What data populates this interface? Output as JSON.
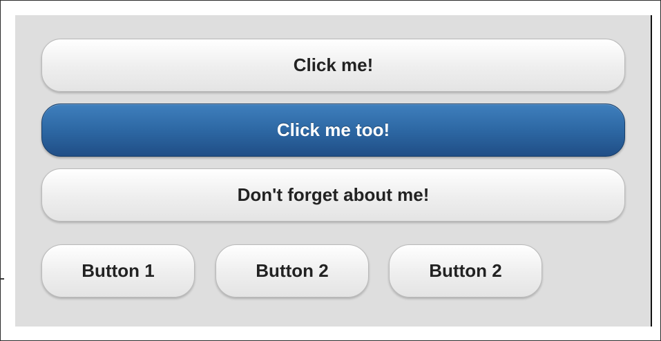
{
  "buttons": {
    "primary_label": "Click me!",
    "secondary_label": "Click me too!",
    "tertiary_label": "Don't forget about me!"
  },
  "inline_buttons": [
    {
      "label": "Button 1"
    },
    {
      "label": "Button 2"
    },
    {
      "label": "Button 2"
    }
  ],
  "colors": {
    "panel_background": "#dedede",
    "button_light": "#f2f2f2",
    "button_active_blue": "#2d68a4",
    "button_text_dark": "#222222",
    "button_text_light": "#ffffff"
  }
}
